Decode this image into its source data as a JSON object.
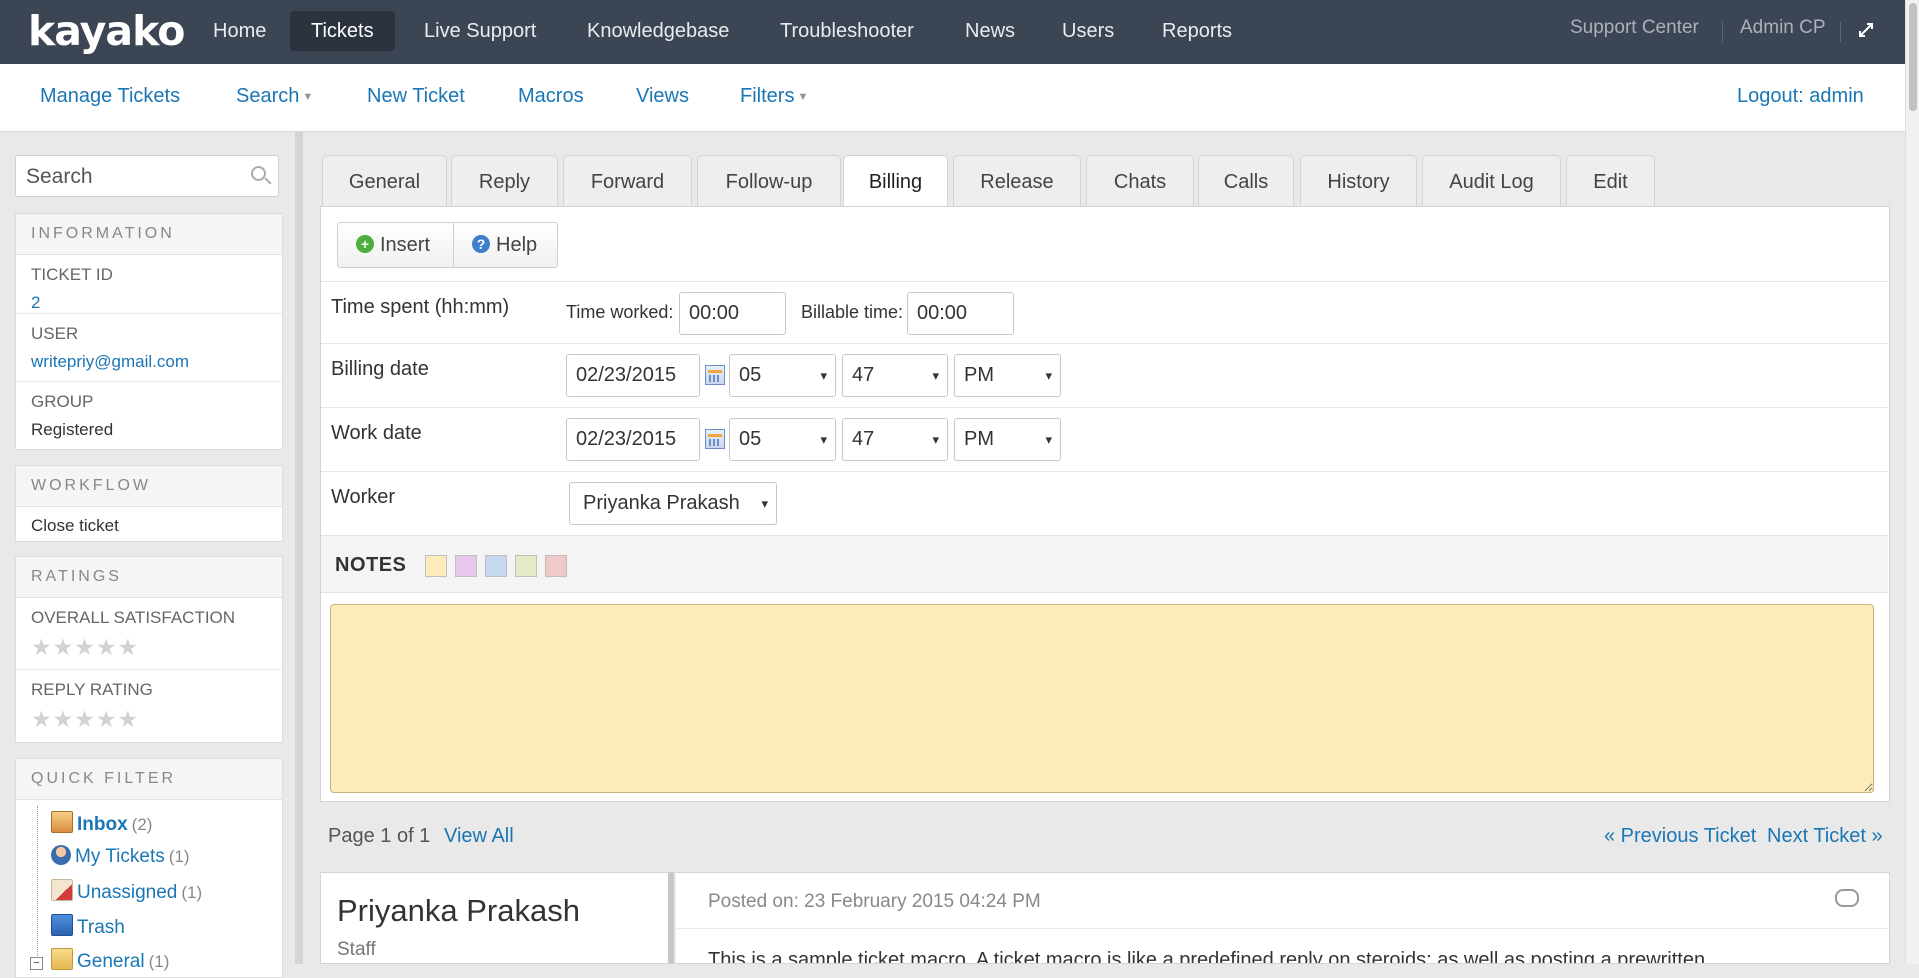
{
  "app": {
    "logo": "kayako"
  },
  "topnav": {
    "items": [
      {
        "label": "Home"
      },
      {
        "label": "Tickets"
      },
      {
        "label": "Live Support"
      },
      {
        "label": "Knowledgebase"
      },
      {
        "label": "Troubleshooter"
      },
      {
        "label": "News"
      },
      {
        "label": "Users"
      },
      {
        "label": "Reports"
      }
    ],
    "active": "Tickets",
    "support_center": "Support Center",
    "admin_cp": "Admin CP"
  },
  "subnav": {
    "manage_tickets": "Manage Tickets",
    "search": "Search",
    "new_ticket": "New Ticket",
    "macros": "Macros",
    "views": "Views",
    "filters": "Filters",
    "logout": "Logout: admin"
  },
  "sidebar": {
    "search_placeholder": "Search",
    "information": {
      "title": "INFORMATION",
      "ticket_id_label": "TICKET ID",
      "ticket_id": "2",
      "user_label": "USER",
      "user": "writepriy@gmail.com",
      "group_label": "GROUP",
      "group": "Registered"
    },
    "workflow": {
      "title": "WORKFLOW",
      "close_ticket": "Close ticket"
    },
    "ratings": {
      "title": "RATINGS",
      "overall_label": "OVERALL SATISFACTION",
      "overall_stars": 0,
      "reply_label": "REPLY RATING",
      "reply_stars": 0
    },
    "quick_filter": {
      "title": "QUICK FILTER",
      "items": [
        {
          "label": "Inbox",
          "count": "(2)"
        },
        {
          "label": "My Tickets",
          "count": "(1)"
        },
        {
          "label": "Unassigned",
          "count": "(1)"
        },
        {
          "label": "Trash",
          "count": ""
        },
        {
          "label": "General",
          "count": "(1)"
        }
      ]
    }
  },
  "tabs": [
    "General",
    "Reply",
    "Forward",
    "Follow-up",
    "Billing",
    "Release",
    "Chats",
    "Calls",
    "History",
    "Audit Log",
    "Edit"
  ],
  "active_tab": "Billing",
  "toolbar": {
    "insert": "Insert",
    "help": "Help"
  },
  "billing": {
    "time_spent_label": "Time spent (hh:mm)",
    "time_worked_label": "Time worked:",
    "time_worked": "00:00",
    "billable_label": "Billable time:",
    "billable": "00:00",
    "billing_date_label": "Billing date",
    "billing_date": "02/23/2015",
    "billing_hour": "05",
    "billing_minute": "47",
    "billing_ampm": "PM",
    "work_date_label": "Work date",
    "work_date": "02/23/2015",
    "work_hour": "05",
    "work_minute": "47",
    "work_ampm": "PM",
    "worker_label": "Worker",
    "worker": "Priyanka Prakash"
  },
  "notes": {
    "label": "NOTES",
    "swatch_colors": [
      "#fdecb9",
      "#e6c9ea",
      "#c8d8ee",
      "#e4ecc7",
      "#f0c9c9"
    ],
    "value": ""
  },
  "pager": {
    "page_text": "Page 1 of 1",
    "view_all": "View All",
    "previous": "« Previous Ticket",
    "next": "Next Ticket »"
  },
  "post": {
    "author": "Priyanka Prakash",
    "role": "Staff",
    "posted_on": "Posted on: 23 February 2015 04:24 PM",
    "text": "This is a sample ticket macro. A ticket macro is like a predefined reply on steroids: as well as posting a prewritten"
  }
}
